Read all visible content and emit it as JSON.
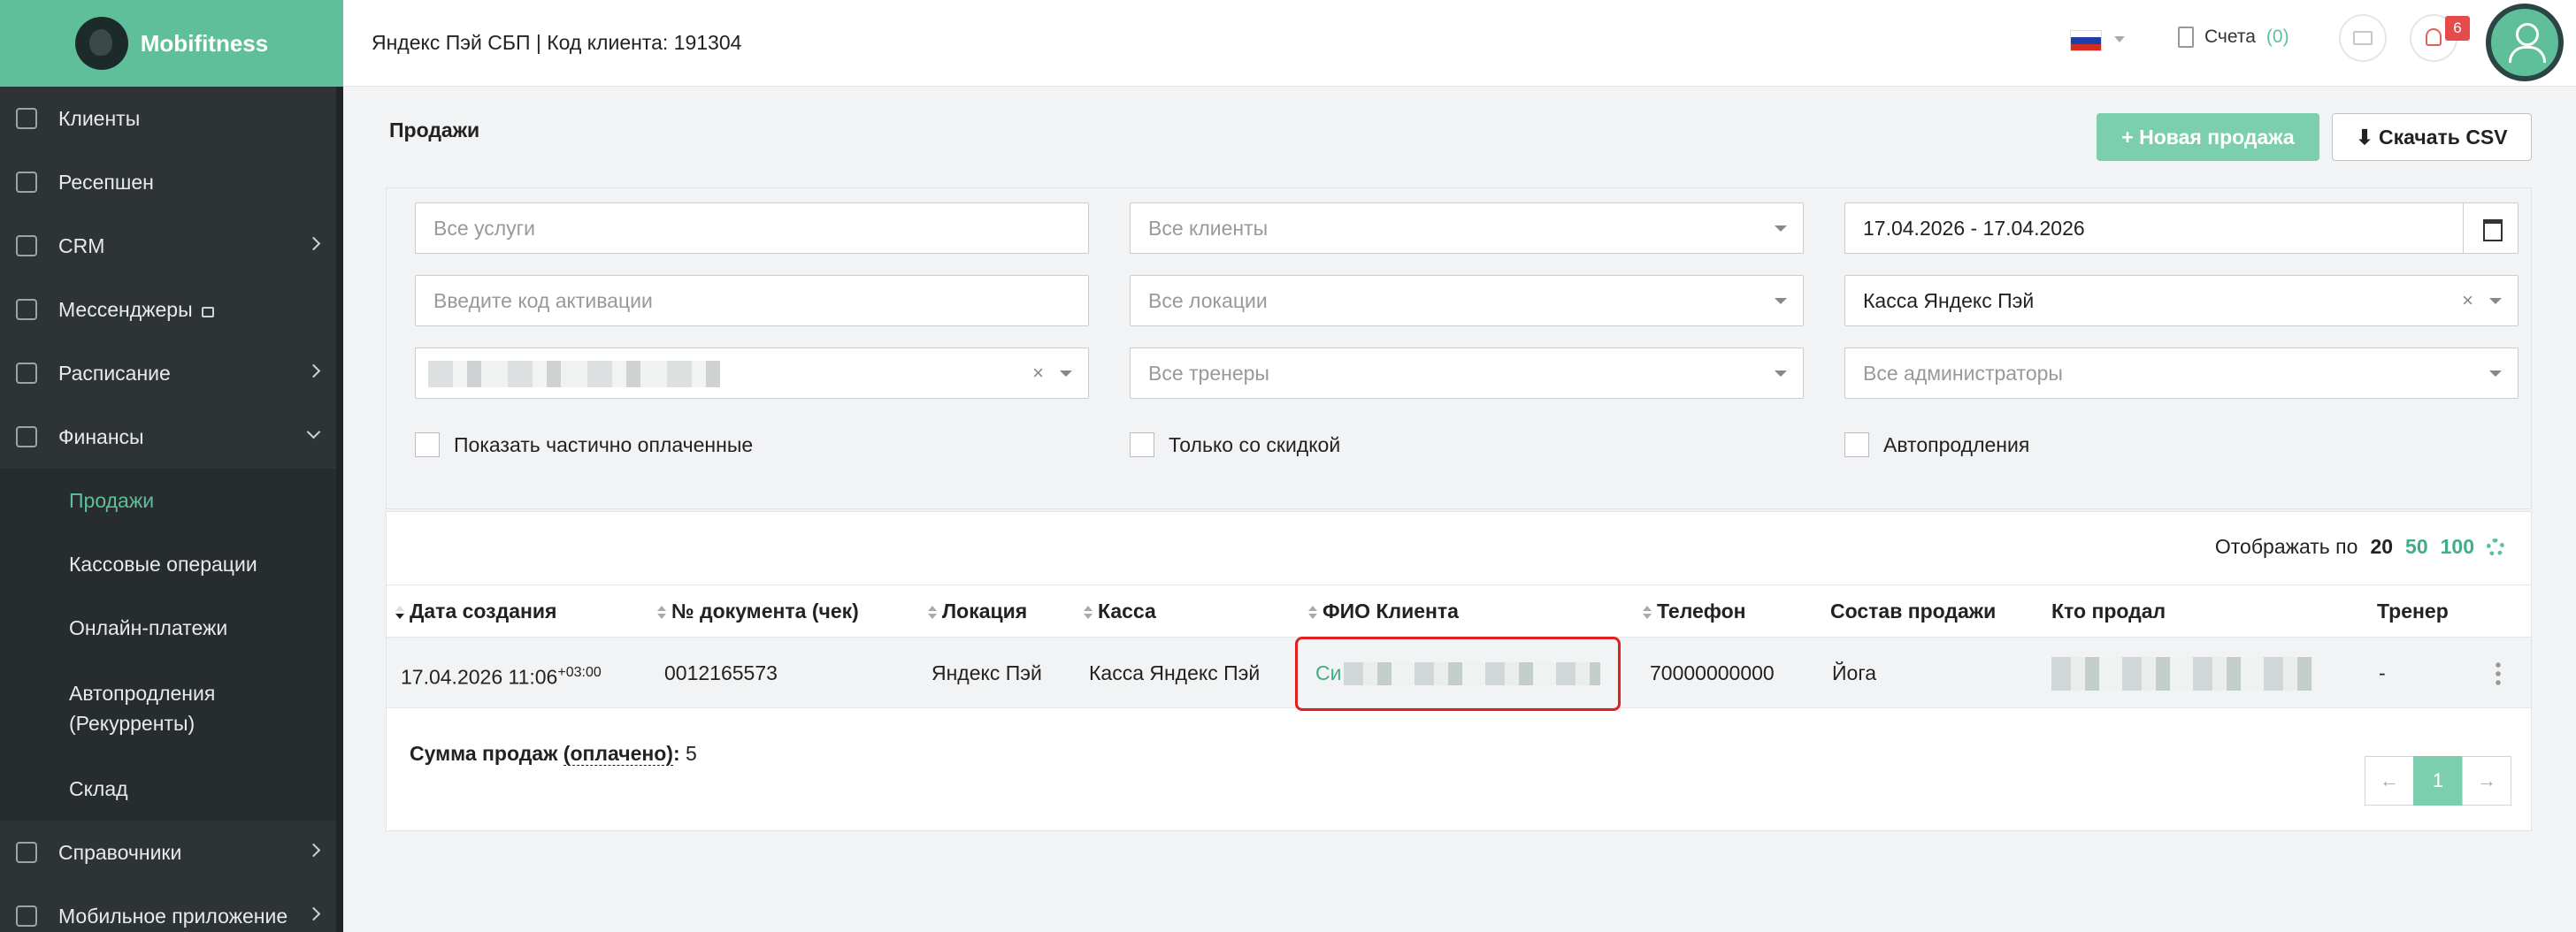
{
  "brand": {
    "name": "Mobifitness"
  },
  "sidebar": {
    "items": [
      {
        "label": "Клиенты",
        "icon": "users-icon"
      },
      {
        "label": "Ресепшен",
        "icon": "clipboard-icon"
      },
      {
        "label": "CRM",
        "icon": "list-icon"
      },
      {
        "label": "Мессенджеры",
        "icon": "chat-icon"
      },
      {
        "label": "Расписание",
        "icon": "calendar-icon"
      },
      {
        "label": "Финансы",
        "icon": "cart-icon"
      },
      {
        "label": "Справочники",
        "icon": "home-icon"
      },
      {
        "label": "Мобильное приложение",
        "icon": "phone-icon"
      }
    ],
    "finance_sub": [
      "Продажи",
      "Кассовые операции",
      "Онлайн-платежи",
      "Автопродления (Рекурренты)",
      "Склад"
    ]
  },
  "topbar": {
    "title": "Яндекс Пэй СБП | Код клиента: 191304",
    "bills_label": "Счета",
    "bills_count": "(0)",
    "notifications": "6"
  },
  "page": {
    "title": "Продажи",
    "new_sale": "Новая продажа",
    "download_csv": "Скачать CSV"
  },
  "filters": {
    "services_placeholder": "Все услуги",
    "clients_placeholder": "Все клиенты",
    "date_range": "17.04.2026 - 17.04.2026",
    "activation_placeholder": "Введите код активации",
    "locations_placeholder": "Все локации",
    "cashbox_value": "Касса Яндекс Пэй",
    "trainers_placeholder": "Все тренеры",
    "admins_placeholder": "Все администраторы",
    "check_partial": "Показать частично оплаченные",
    "check_discount": "Только со скидкой",
    "check_autorenew": "Автопродления"
  },
  "table": {
    "per_page_label": "Отображать по",
    "per_page_options": [
      "20",
      "50",
      "100"
    ],
    "columns": [
      "Дата создания",
      "№ документа (чек)",
      "Локация",
      "Касса",
      "ФИО Клиента",
      "Телефон",
      "Состав продажи",
      "Кто продал",
      "Тренер"
    ],
    "rows": [
      {
        "date": "17.04.2026 11:06",
        "tz": "+03:00",
        "doc": "0012165573",
        "location": "Яндекс Пэй",
        "cashbox": "Касса Яндекс Пэй",
        "client_prefix": "Си",
        "phone": "70000000000",
        "content": "Йога",
        "trainer": "-"
      }
    ],
    "summary_label": "Сумма продаж",
    "summary_paid": "(оплачено)",
    "summary_value": "5"
  },
  "pagination": {
    "prev": "←",
    "current": "1",
    "next": "→"
  },
  "colors": {
    "accent": "#5fbf9b",
    "sidebar": "#2e3436",
    "highlight": "#e02020"
  }
}
